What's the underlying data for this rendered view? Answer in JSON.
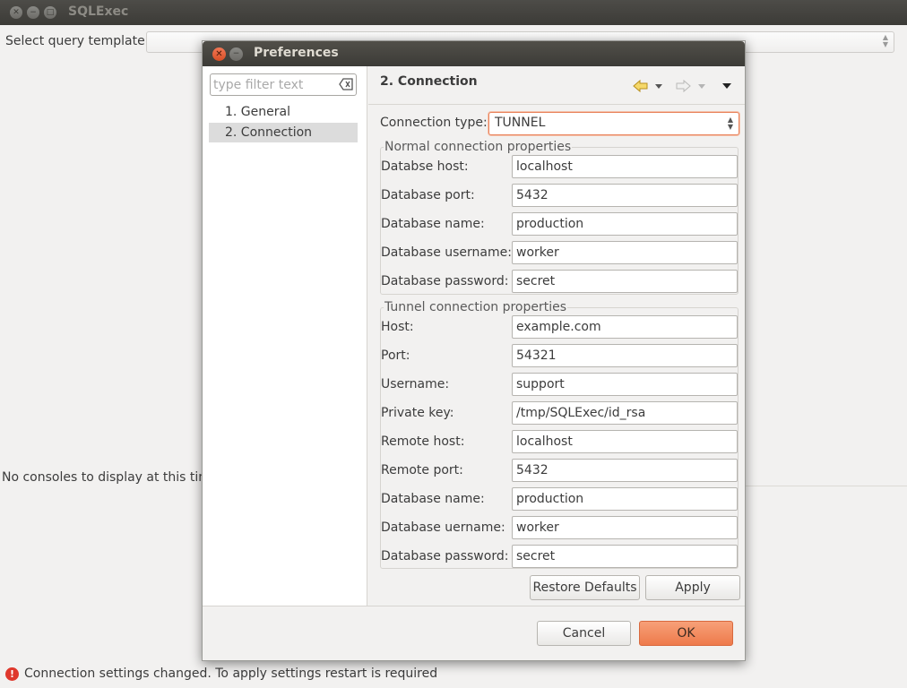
{
  "main": {
    "title": "SQLExec",
    "template_label": "Select query template:",
    "template_value": "",
    "console_message": "No consoles to display at this time"
  },
  "status": {
    "icon": "error-icon",
    "message": "Connection settings changed. To apply settings restart is required"
  },
  "dialog": {
    "title": "Preferences",
    "filter_placeholder": "type filter text",
    "tree": [
      {
        "label": "1. General",
        "selected": false
      },
      {
        "label": "2. Connection",
        "selected": true
      }
    ],
    "page_title": "2. Connection",
    "connection_type_label": "Connection type:",
    "connection_type_value": "TUNNEL",
    "normal_group": {
      "title": "Normal connection properties",
      "fields": [
        {
          "label": "Databse host:",
          "value": "localhost"
        },
        {
          "label": "Database port:",
          "value": "5432"
        },
        {
          "label": "Database name:",
          "value": "production"
        },
        {
          "label": "Database username:",
          "value": "worker"
        },
        {
          "label": "Database password:",
          "value": "secret"
        }
      ]
    },
    "tunnel_group": {
      "title": "Tunnel connection properties",
      "fields": [
        {
          "label": "Host:",
          "value": "example.com"
        },
        {
          "label": "Port:",
          "value": "54321"
        },
        {
          "label": "Username:",
          "value": "support"
        },
        {
          "label": "Private key:",
          "value": "/tmp/SQLExec/id_rsa"
        },
        {
          "label": "Remote host:",
          "value": "localhost"
        },
        {
          "label": "Remote port:",
          "value": "5432"
        },
        {
          "label": "Database name:",
          "value": "production"
        },
        {
          "label": "Database uername:",
          "value": "worker"
        },
        {
          "label": "Database password:",
          "value": "secret"
        }
      ]
    },
    "restore_defaults_label": "Restore Defaults",
    "apply_label": "Apply",
    "cancel_label": "Cancel",
    "ok_label": "OK"
  },
  "colors": {
    "accent": "#ee7a4b",
    "error": "#df382c",
    "titlebar": "#3c3b37"
  }
}
